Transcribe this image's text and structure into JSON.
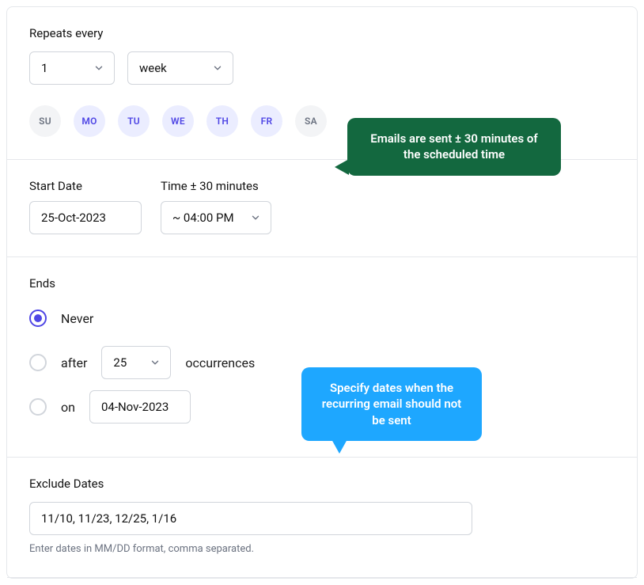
{
  "repeats": {
    "label": "Repeats every",
    "interval": "1",
    "unit": "week",
    "days": [
      {
        "abbr": "SU",
        "selected": false
      },
      {
        "abbr": "MO",
        "selected": true
      },
      {
        "abbr": "TU",
        "selected": true
      },
      {
        "abbr": "WE",
        "selected": true
      },
      {
        "abbr": "TH",
        "selected": true
      },
      {
        "abbr": "FR",
        "selected": true
      },
      {
        "abbr": "SA",
        "selected": false
      }
    ]
  },
  "start": {
    "date_label": "Start Date",
    "date": "25-Oct-2023",
    "time_label": "Time ± 30 minutes",
    "time": "~ 04:00 PM"
  },
  "ends": {
    "label": "Ends",
    "never": "Never",
    "after_label": "after",
    "occurrences_count": "25",
    "occurrences_word": "occurrences",
    "on_label": "on",
    "on_date": "04-Nov-2023"
  },
  "exclude": {
    "label": "Exclude Dates",
    "value": "11/10, 11/23, 12/25, 1/16",
    "helper": "Enter dates in MM/DD format, comma separated."
  },
  "callouts": {
    "time": "Emails are sent ± 30 minutes of the scheduled time",
    "exclude": "Specify dates when the recurring email should not be sent"
  }
}
